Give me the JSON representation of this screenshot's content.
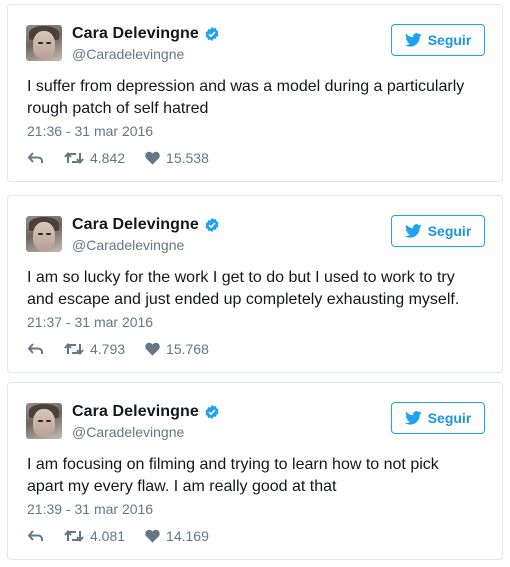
{
  "tweets": [
    {
      "author": "Cara Delevingne",
      "handle": "@Caradelevingne",
      "follow_label": "Seguir",
      "text": "I suffer from depression and was a model during a particularly rough patch of self hatred",
      "timestamp": "21:36 - 31 mar 2016",
      "retweets": "4.842",
      "likes": "15.538"
    },
    {
      "author": "Cara Delevingne",
      "handle": "@Caradelevingne",
      "follow_label": "Seguir",
      "text": "I am so lucky for the work I get to do but I used to work to try and escape and just ended up completely exhausting myself.",
      "timestamp": "21:37 - 31 mar 2016",
      "retweets": "4.793",
      "likes": "15.768"
    },
    {
      "author": "Cara Delevingne",
      "handle": "@Caradelevingne",
      "follow_label": "Seguir",
      "text": "I am focusing on filming and trying to learn how to not pick apart my every flaw. I am really good at that",
      "timestamp": "21:39 - 31 mar 2016",
      "retweets": "4.081",
      "likes": "14.169"
    }
  ],
  "colors": {
    "accent": "#1da1f2",
    "verified": "#1da1f2",
    "muted": "#657786",
    "text": "#14171a",
    "border": "#e1e8ed"
  },
  "icons": {
    "verified": "verified-badge-icon",
    "bird": "twitter-bird-icon",
    "reply": "reply-icon",
    "retweet": "retweet-icon",
    "like": "heart-icon"
  }
}
